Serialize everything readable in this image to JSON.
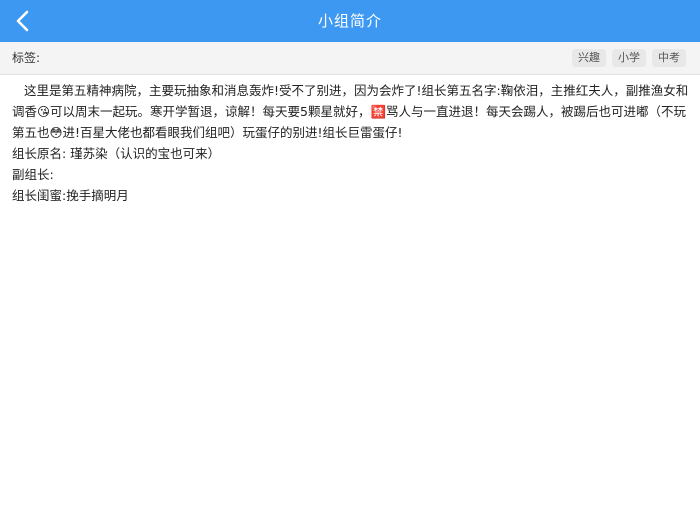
{
  "header": {
    "title": "小组简介",
    "back_icon": "chevron-left-icon"
  },
  "tags": {
    "label": "标签:",
    "items": [
      "兴趣",
      "小学",
      "中考"
    ]
  },
  "content": {
    "intro": "这里是第五精神病院，主要玩抽象和消息轰炸!受不了别进，因为会炸了!组长第五名字:鞠依泪，主推红夫人，副推渔女和调香😘可以周末一起玩。寒开学暂退，谅解！每天要5颗星就好，🈲骂人与一直进退！每天会踢人，被踢后也可进嘟（不玩第五也😳进!百星大佬也都看眼我们组吧）玩蛋仔的别进!组长巨雷蛋仔!",
    "leader_original_name": "组长原名: 瑾苏染（认识的宝也可来）",
    "vice_leader": "副组长:",
    "leader_bestie": "组长闺蜜:挽手摘明月"
  }
}
